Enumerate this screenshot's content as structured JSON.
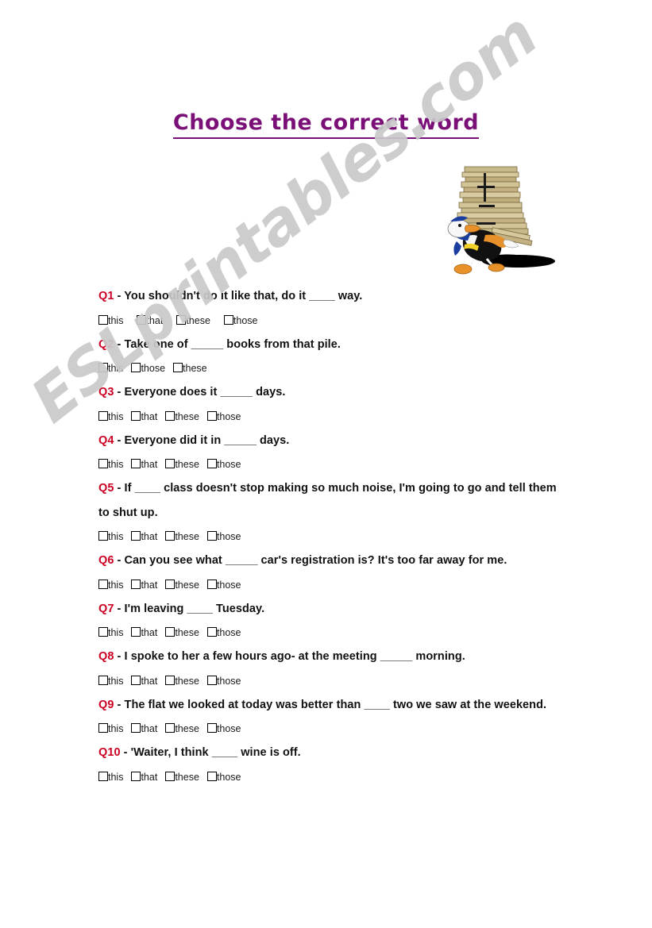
{
  "document": {
    "title": "Choose the correct word",
    "title_color": "#7a1077",
    "question_number_color": "#cc0022",
    "body_color": "#111111",
    "background_color": "#ffffff"
  },
  "watermark": {
    "text": "ESLprintables.com",
    "color": "#c9c9c9"
  },
  "clipart": {
    "name": "duck-carrying-stack-of-books"
  },
  "questions": [
    {
      "number": "Q1",
      "dash": "-",
      "text": "You shouldn't do it like that, do it ____ way.",
      "options": [
        "this",
        "that",
        "these",
        "those"
      ],
      "wide": true
    },
    {
      "number": "Q2",
      "dash": "-",
      "text": "Take one of _____ books from that pile.",
      "options": [
        "this",
        "those",
        "these"
      ],
      "wide": false
    },
    {
      "number": "Q3",
      "dash": "-",
      "text": "Everyone does it _____ days.",
      "options": [
        "this",
        "that",
        "these",
        "those"
      ],
      "wide": false
    },
    {
      "number": "Q4",
      "dash": "-",
      "text": "Everyone did it in _____ days.",
      "options": [
        "this",
        "that",
        "these",
        "those"
      ],
      "wide": false
    },
    {
      "number": "Q5",
      "dash": "-",
      "text": "If ____ class doesn't stop making so much noise, I'm going to go and tell them to shut up.",
      "options": [
        "this",
        "that",
        "these",
        "those"
      ],
      "wide": false
    },
    {
      "number": "Q6",
      "dash": "-",
      "text": "Can you see what _____ car's registration is? It's too far away for me.",
      "options": [
        "this",
        "that",
        "these",
        "those"
      ],
      "wide": false
    },
    {
      "number": "Q7",
      "dash": "-",
      "text": "I'm leaving ____ Tuesday.",
      "options": [
        "this",
        "that",
        "these",
        "those"
      ],
      "wide": false
    },
    {
      "number": "Q8",
      "dash": "-",
      "text": "I spoke to her a few hours ago- at the meeting _____ morning.",
      "options": [
        "this",
        "that",
        "these",
        "those"
      ],
      "wide": false
    },
    {
      "number": "Q9",
      "dash": "-",
      "text": "The flat we looked at today was better than ____ two we saw at the weekend.",
      "options": [
        "this",
        "that",
        "these",
        "those"
      ],
      "wide": false
    },
    {
      "number": "Q10",
      "dash": "-",
      "text": "'Waiter, I think ____ wine is off.",
      "options": [
        "this",
        "that",
        "these",
        "those"
      ],
      "wide": false
    }
  ]
}
